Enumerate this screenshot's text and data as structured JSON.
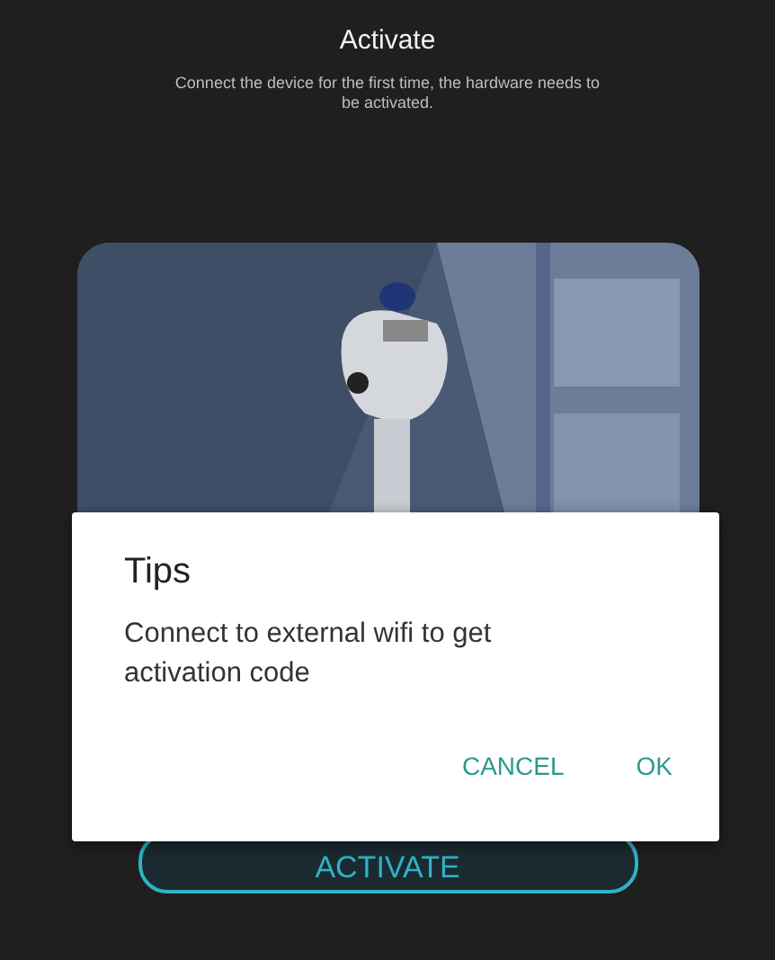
{
  "header": {
    "title": "Activate",
    "subtitle": "Connect the device for the first time, the hardware needs to be activated."
  },
  "activate_button": {
    "label": "ACTIVATE"
  },
  "dialog": {
    "title": "Tips",
    "message": "Connect to external wifi to get activation code",
    "buttons": [
      {
        "label": "CANCEL"
      },
      {
        "label": "OK"
      }
    ]
  }
}
